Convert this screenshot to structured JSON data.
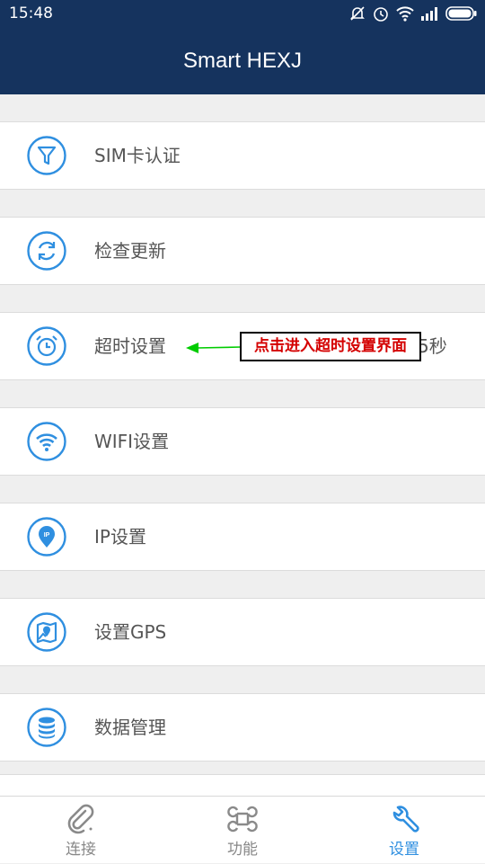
{
  "status_bar": {
    "time": "15:48",
    "icons": [
      "notification-off-icon",
      "alarm-icon",
      "wifi-icon",
      "signal-icon",
      "battery-icon"
    ]
  },
  "header": {
    "title": "Smart HEXJ"
  },
  "menu": {
    "items": [
      {
        "label": "SIM卡认证",
        "icon": "filter-icon"
      },
      {
        "label": "检查更新",
        "icon": "refresh-icon"
      },
      {
        "label": "超时设置",
        "icon": "alarm-clock-icon",
        "value": "5秒"
      },
      {
        "label": "WIFI设置",
        "icon": "wifi-icon"
      },
      {
        "label": "IP设置",
        "icon": "ip-location-icon"
      },
      {
        "label": "设置GPS",
        "icon": "map-icon"
      },
      {
        "label": "数据管理",
        "icon": "database-icon"
      }
    ]
  },
  "annotation": {
    "text": "点击进入超时设置界面"
  },
  "tabs": [
    {
      "label": "连接",
      "icon": "paperclip-icon",
      "active": false
    },
    {
      "label": "功能",
      "icon": "command-icon",
      "active": false
    },
    {
      "label": "设置",
      "icon": "wrench-icon",
      "active": true
    }
  ],
  "colors": {
    "header": "#15335e",
    "accent": "#2f8fe0",
    "inactive": "#888888",
    "annotation_text": "#d40000",
    "arrow": "#00cc00"
  }
}
